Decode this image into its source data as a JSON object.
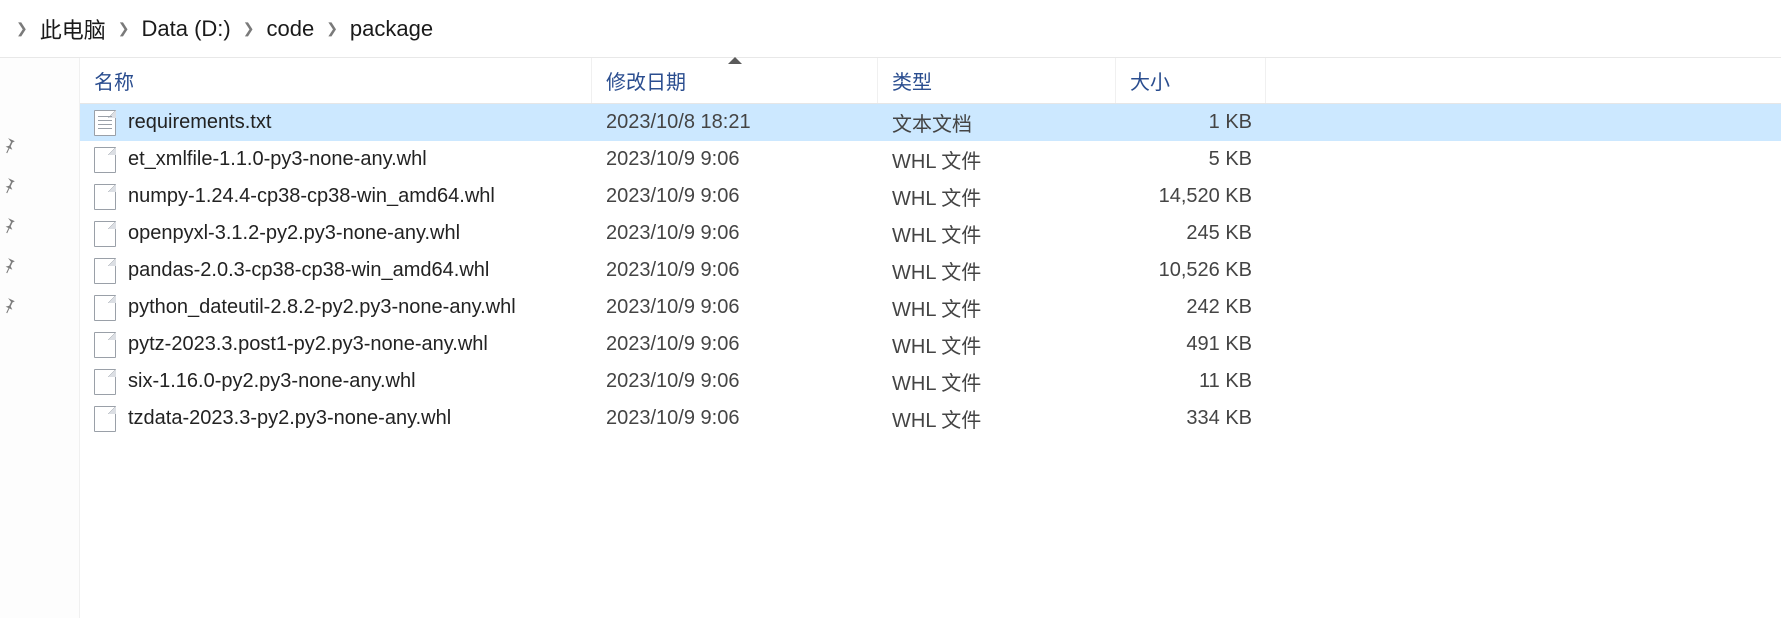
{
  "breadcrumb": {
    "items": [
      {
        "label": "此电脑"
      },
      {
        "label": "Data (D:)"
      },
      {
        "label": "code"
      },
      {
        "label": "package"
      }
    ]
  },
  "columns": {
    "name": "名称",
    "date": "修改日期",
    "type": "类型",
    "size": "大小",
    "sorted": "date",
    "sort_dir": "asc"
  },
  "files": [
    {
      "name": "requirements.txt",
      "date": "2023/10/8 18:21",
      "type": "文本文档",
      "size": "1 KB",
      "icon": "txt",
      "selected": true
    },
    {
      "name": "et_xmlfile-1.1.0-py3-none-any.whl",
      "date": "2023/10/9 9:06",
      "type": "WHL 文件",
      "size": "5 KB",
      "icon": "whl",
      "selected": false
    },
    {
      "name": "numpy-1.24.4-cp38-cp38-win_amd64.whl",
      "date": "2023/10/9 9:06",
      "type": "WHL 文件",
      "size": "14,520 KB",
      "icon": "whl",
      "selected": false
    },
    {
      "name": "openpyxl-3.1.2-py2.py3-none-any.whl",
      "date": "2023/10/9 9:06",
      "type": "WHL 文件",
      "size": "245 KB",
      "icon": "whl",
      "selected": false
    },
    {
      "name": "pandas-2.0.3-cp38-cp38-win_amd64.whl",
      "date": "2023/10/9 9:06",
      "type": "WHL 文件",
      "size": "10,526 KB",
      "icon": "whl",
      "selected": false
    },
    {
      "name": "python_dateutil-2.8.2-py2.py3-none-any.whl",
      "date": "2023/10/9 9:06",
      "type": "WHL 文件",
      "size": "242 KB",
      "icon": "whl",
      "selected": false
    },
    {
      "name": "pytz-2023.3.post1-py2.py3-none-any.whl",
      "date": "2023/10/9 9:06",
      "type": "WHL 文件",
      "size": "491 KB",
      "icon": "whl",
      "selected": false
    },
    {
      "name": "six-1.16.0-py2.py3-none-any.whl",
      "date": "2023/10/9 9:06",
      "type": "WHL 文件",
      "size": "11 KB",
      "icon": "whl",
      "selected": false
    },
    {
      "name": "tzdata-2023.3-py2.py3-none-any.whl",
      "date": "2023/10/9 9:06",
      "type": "WHL 文件",
      "size": "334 KB",
      "icon": "whl",
      "selected": false
    }
  ],
  "sidebar": {
    "pins": 5
  }
}
